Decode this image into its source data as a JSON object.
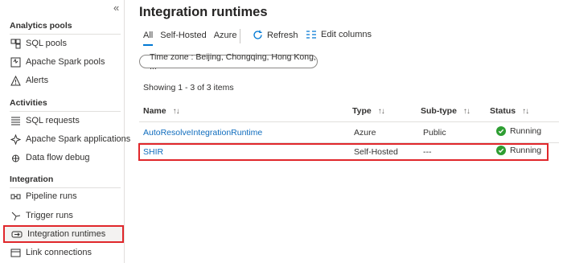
{
  "sidebar": {
    "collapse_glyph": "«",
    "sections": [
      {
        "label": "Analytics pools",
        "items": [
          {
            "label": "SQL pools",
            "icon": "sql-pool-icon"
          },
          {
            "label": "Apache Spark pools",
            "icon": "spark-pool-icon"
          },
          {
            "label": "Alerts",
            "icon": "alert-icon"
          }
        ]
      },
      {
        "label": "Activities",
        "items": [
          {
            "label": "SQL requests",
            "icon": "list-icon"
          },
          {
            "label": "Apache Spark applications",
            "icon": "spark-app-icon"
          },
          {
            "label": "Data flow debug",
            "icon": "debug-icon"
          }
        ]
      },
      {
        "label": "Integration",
        "items": [
          {
            "label": "Pipeline runs",
            "icon": "pipeline-icon"
          },
          {
            "label": "Trigger runs",
            "icon": "trigger-icon"
          },
          {
            "label": "Integration runtimes",
            "icon": "runtime-icon",
            "selected": true
          },
          {
            "label": "Link connections",
            "icon": "link-icon"
          }
        ]
      }
    ]
  },
  "main": {
    "title": "Integration runtimes",
    "tabs": [
      "All",
      "Self-Hosted",
      "Azure"
    ],
    "toolbar": {
      "refresh": "Refresh",
      "edit_columns": "Edit columns"
    },
    "filter": {
      "label": "Time zone : Beijing, Chongqing, Hong Kong, ..."
    },
    "showing": "Showing 1 - 3 of 3 items",
    "columns": [
      "Name",
      "Type",
      "Sub-type",
      "Status"
    ],
    "sort_glyph": "↑↓",
    "rows": [
      {
        "name": "AutoResolveIntegrationRuntime",
        "type": "Azure",
        "subtype": "Public",
        "status": "Running"
      },
      {
        "name": "SHIR",
        "type": "Self-Hosted",
        "subtype": "---",
        "status": "Running"
      }
    ]
  },
  "colors": {
    "accent": "#0078d4",
    "link": "#0f6cbd",
    "highlight": "#e0272b",
    "running": "#2e9e32"
  }
}
